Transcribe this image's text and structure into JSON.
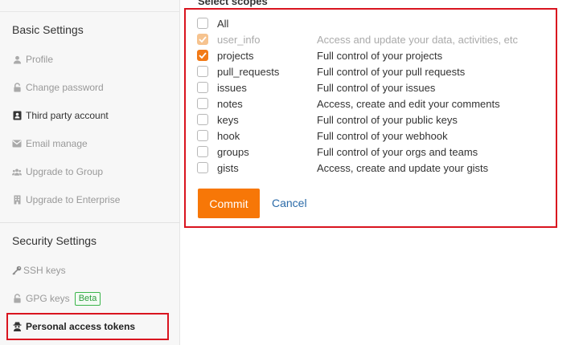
{
  "sidebar": {
    "basic_section_title": "Basic Settings",
    "basic_items": [
      {
        "label": "Profile",
        "icon": "user-icon"
      },
      {
        "label": "Change password",
        "icon": "lock-icon"
      },
      {
        "label": "Third party account",
        "icon": "id-card-icon"
      },
      {
        "label": "Email manage",
        "icon": "envelope-icon"
      },
      {
        "label": "Upgrade to Group",
        "icon": "group-icon"
      },
      {
        "label": "Upgrade to Enterprise",
        "icon": "building-icon"
      }
    ],
    "security_section_title": "Security Settings",
    "security_items": [
      {
        "label": "SSH keys",
        "icon": "key-icon"
      },
      {
        "label": "GPG keys",
        "icon": "lock-icon",
        "badge": "Beta"
      },
      {
        "label": "Personal access tokens",
        "icon": "user-secret-icon"
      }
    ]
  },
  "scopes": {
    "heading": "Select scopes",
    "all_label": "All",
    "items": [
      {
        "name": "user_info",
        "description": "Access and update your data, activities, etc",
        "checked": true,
        "disabled": true
      },
      {
        "name": "projects",
        "description": "Full control of your projects",
        "checked": true,
        "disabled": false
      },
      {
        "name": "pull_requests",
        "description": "Full control of your pull requests",
        "checked": false,
        "disabled": false
      },
      {
        "name": "issues",
        "description": "Full control of your issues",
        "checked": false,
        "disabled": false
      },
      {
        "name": "notes",
        "description": "Access, create and edit your comments",
        "checked": false,
        "disabled": false
      },
      {
        "name": "keys",
        "description": "Full control of your public keys",
        "checked": false,
        "disabled": false
      },
      {
        "name": "hook",
        "description": "Full control of your webhook",
        "checked": false,
        "disabled": false
      },
      {
        "name": "groups",
        "description": "Full control of your orgs and teams",
        "checked": false,
        "disabled": false
      },
      {
        "name": "gists",
        "description": "Access, create and update your gists",
        "checked": false,
        "disabled": false
      }
    ]
  },
  "actions": {
    "commit_label": "Commit",
    "cancel_label": "Cancel"
  },
  "colors": {
    "accent": "#f77707",
    "highlight_border": "#d9141f",
    "link": "#2a6aa8",
    "badge": "#3bb54a"
  }
}
